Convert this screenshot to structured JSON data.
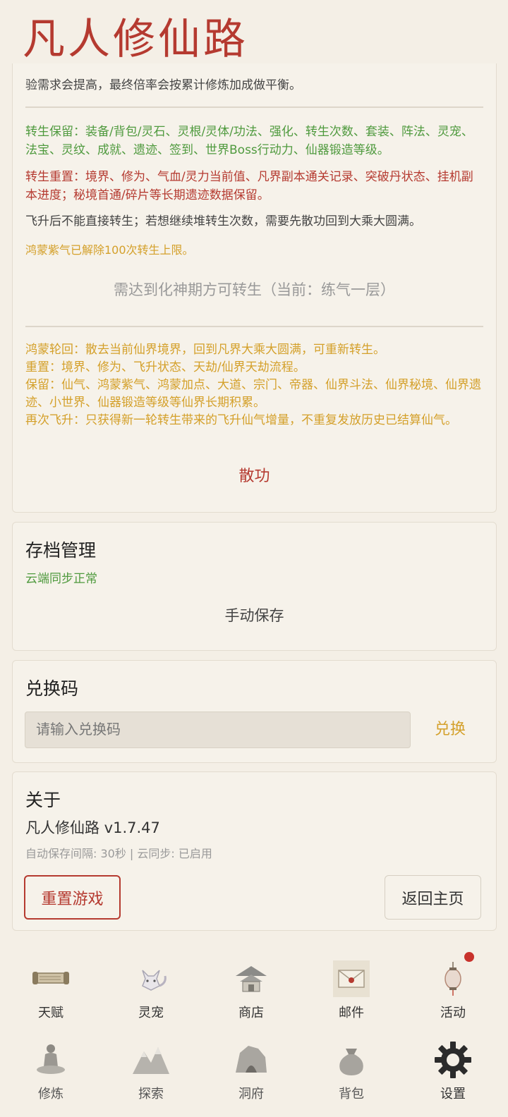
{
  "app": {
    "title": "凡人修仙路"
  },
  "rebirth": {
    "partial_top": "验需求会提高，最终倍率会按累计修炼加成做平衡。",
    "keep_text": "转生保留：装备/背包/灵石、灵根/灵体/功法、强化、转生次数、套装、阵法、灵宠、法宝、灵纹、成就、遗迹、签到、世界Boss行动力、仙器锻造等级。",
    "reset_text": "转生重置：境界、修为、气血/灵力当前值、凡界副本通关记录、突破丹状态、挂机副本进度；秘境首通/碎片等长期遗迹数据保留。",
    "note_text": "飞升后不能直接转生；若想继续堆转生次数，需要先散功回到大乘大圆满。",
    "limit_text": "鸿蒙紫气已解除100次转生上限。",
    "requirement": "需达到化神期方可转生（当前：练气一层）",
    "cycle_lines": [
      "鸿蒙轮回：散去当前仙界境界，回到凡界大乘大圆满，可重新转生。",
      "重置：境界、修为、飞升状态、天劫/仙界天劫流程。",
      "保留：仙气、鸿蒙紫气、鸿蒙加点、大道、宗门、帝器、仙界斗法、仙界秘境、仙界遗迹、小世界、仙器锻造等级等仙界长期积累。",
      "再次飞升：只获得新一轮转生带来的飞升仙气增量，不重复发放历史已结算仙气。"
    ],
    "disperse_button": "散功"
  },
  "save": {
    "title": "存档管理",
    "status": "云端同步正常",
    "manual_save_button": "手动保存"
  },
  "redeem": {
    "title": "兑换码",
    "placeholder": "请输入兑换码",
    "button": "兑换"
  },
  "about": {
    "title": "关于",
    "version": "凡人修仙路 v1.7.47",
    "info": "自动保存间隔: 30秒 | 云同步: 已启用",
    "reset_button": "重置游戏",
    "home_button": "返回主页"
  },
  "nav": {
    "row1": [
      {
        "label": "天赋",
        "icon": "scroll-icon"
      },
      {
        "label": "灵宠",
        "icon": "fox-icon"
      },
      {
        "label": "商店",
        "icon": "pavilion-icon"
      },
      {
        "label": "邮件",
        "icon": "envelope-icon"
      },
      {
        "label": "活动",
        "icon": "lantern-icon"
      }
    ],
    "row2": [
      {
        "label": "修炼",
        "icon": "meditation-icon"
      },
      {
        "label": "探索",
        "icon": "mountain-icon"
      },
      {
        "label": "洞府",
        "icon": "cave-icon"
      },
      {
        "label": "背包",
        "icon": "bag-icon"
      },
      {
        "label": "设置",
        "icon": "gear-icon"
      }
    ]
  },
  "colors": {
    "accent_red": "#b53a30",
    "success_green": "#4f9a3e",
    "gold": "#d4a02a",
    "background": "#f4efe6"
  }
}
